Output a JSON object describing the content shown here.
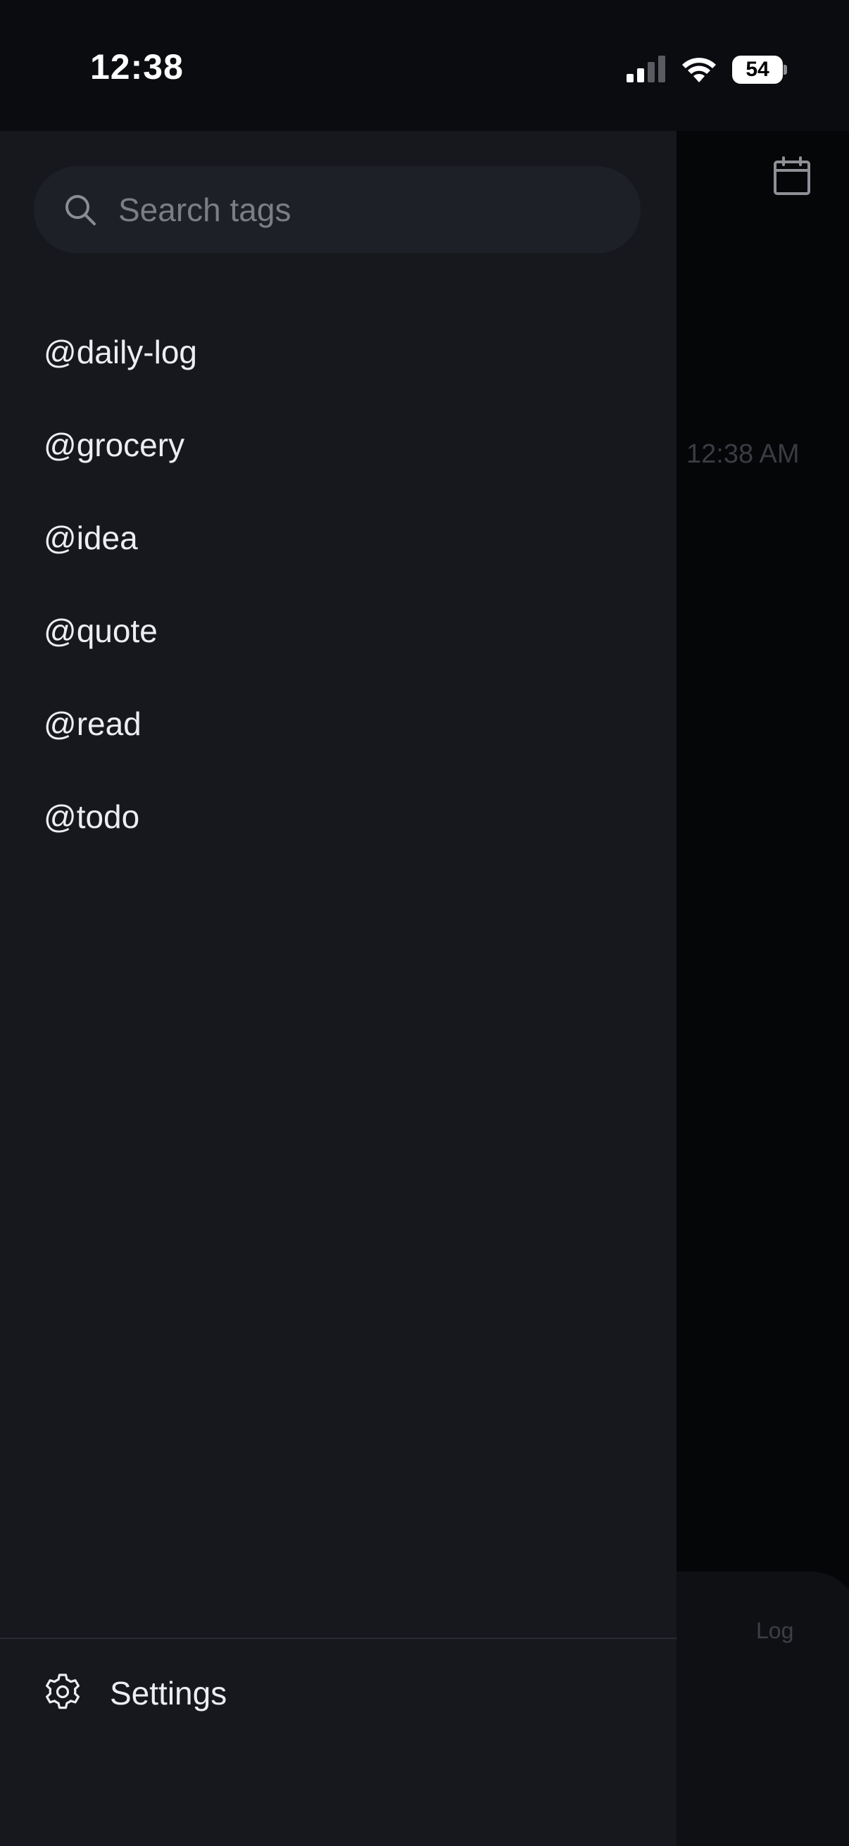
{
  "status_bar": {
    "time": "12:38",
    "battery": "54",
    "icons": [
      "cellular-signal-icon",
      "wifi-icon",
      "battery-icon"
    ]
  },
  "background_app": {
    "timestamp": "12:38 AM",
    "bottom_label": "Log",
    "icons": [
      "calendar-icon"
    ]
  },
  "drawer": {
    "search": {
      "placeholder": "Search tags",
      "value": ""
    },
    "tags": [
      {
        "label": "@daily-log"
      },
      {
        "label": "@grocery"
      },
      {
        "label": "@idea"
      },
      {
        "label": "@quote"
      },
      {
        "label": "@read"
      },
      {
        "label": "@todo"
      }
    ],
    "settings_label": "Settings"
  },
  "colors": {
    "drawer_background": "#17181d",
    "search_background": "#1e2028",
    "text_primary": "#eceef1",
    "text_placeholder": "#7b7e87",
    "app_background": "#050608"
  }
}
